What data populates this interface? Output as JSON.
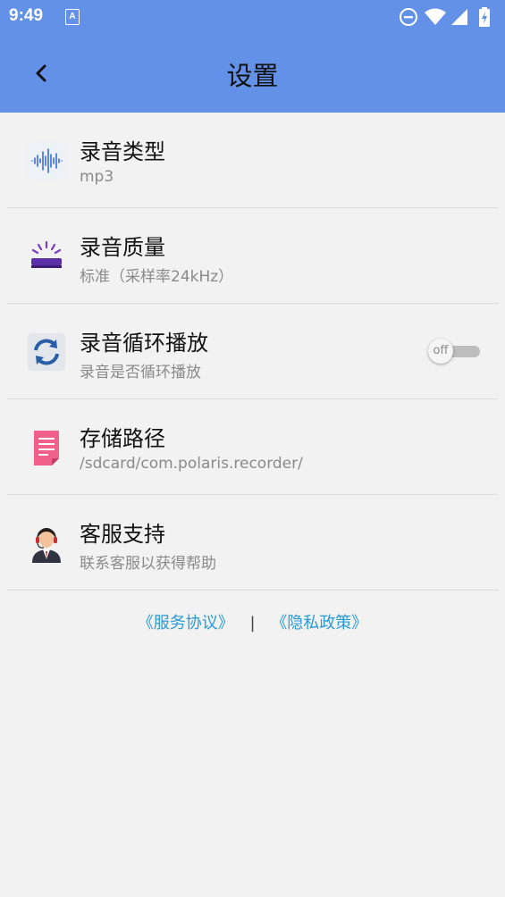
{
  "status_bar": {
    "time": "9:49",
    "notif_letter": "A"
  },
  "header": {
    "title": "设置"
  },
  "settings": [
    {
      "label": "录音类型",
      "sub": "mp3"
    },
    {
      "label": "录音质量",
      "sub": "标准（采样率24kHz）"
    },
    {
      "label": "录音循环播放",
      "sub": "录音是否循环播放",
      "toggle": "off"
    },
    {
      "label": "存储路径",
      "sub": "/sdcard/com.polaris.recorder/"
    },
    {
      "label": "客服支持",
      "sub": "联系客服以获得帮助"
    }
  ],
  "links": {
    "service": "《服务协议》",
    "separator": "|",
    "privacy": "《隐私政策》"
  },
  "colors": {
    "header_bg": "#6491e8",
    "link": "#2b9ad4"
  }
}
